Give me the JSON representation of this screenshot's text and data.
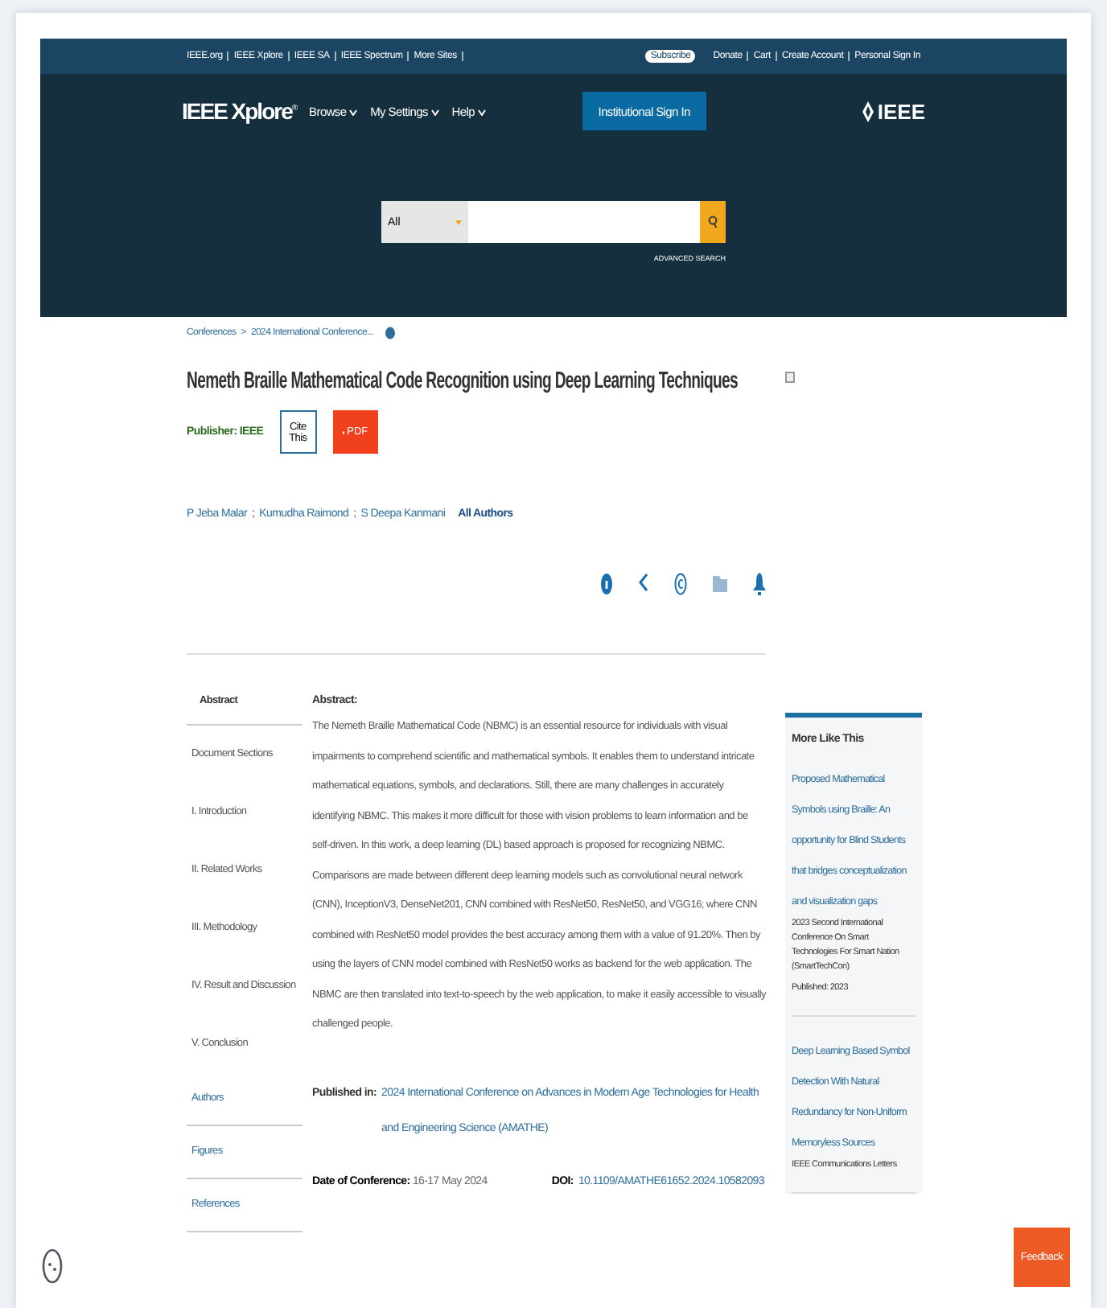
{
  "top_links": [
    "IEEE.org",
    "IEEE Xplore",
    "IEEE SA",
    "IEEE Spectrum",
    "More Sites"
  ],
  "subscribe": "Subscribe",
  "account_links": [
    "Donate",
    "Cart",
    "Create Account",
    "Personal Sign In"
  ],
  "logo": {
    "name": "IEEE Xplore",
    "mark": "®"
  },
  "nav": [
    "Browse",
    "My Settings",
    "Help"
  ],
  "institutional_sign_in": "Institutional Sign In",
  "brand": "IEEE",
  "search": {
    "scope": "All",
    "advanced": "ADVANCED SEARCH"
  },
  "breadcrumb": [
    "Conferences",
    "2024 International Conference..."
  ],
  "breadcrumb_separator": ">",
  "title": "Nemeth Braille Mathematical Code Recognition using Deep Learning Techniques",
  "publisher": "Publisher: IEEE",
  "cite": "Cite This",
  "pdf": "PDF",
  "authors": [
    "P Jeba Malar",
    "Kumudha Raimond",
    "S Deepa Kanmani"
  ],
  "author_separator": ";",
  "all_authors": "All Authors",
  "sections": [
    {
      "label": "Abstract",
      "kind": "tab",
      "selected": true
    },
    {
      "label": "Document Sections",
      "kind": "heading",
      "selected": false
    },
    {
      "label": "I. Introduction",
      "kind": "section",
      "selected": false
    },
    {
      "label": "II. Related Works",
      "kind": "section",
      "selected": false
    },
    {
      "label": "III. Methodology",
      "kind": "section",
      "selected": false
    },
    {
      "label": "IV. Result and Discussion",
      "kind": "section",
      "selected": false
    },
    {
      "label": "V. Conclusion",
      "kind": "section",
      "selected": false
    },
    {
      "label": "Authors",
      "kind": "link",
      "selected": false
    },
    {
      "label": "Figures",
      "kind": "link",
      "selected": false
    },
    {
      "label": "References",
      "kind": "link",
      "selected": false
    }
  ],
  "abstract": {
    "heading": "Abstract:",
    "text": "The Nemeth Braille Mathematical Code (NBMC) is an essential resource for individuals with visual impairments to comprehend scientific and mathematical symbols. It enables them to understand intricate mathematical equations, symbols, and declarations. Still, there are many challenges in accurately identifying NBMC. This makes it more difficult for those with vision problems to learn information and be self-driven. In this work, a deep learning (DL) based approach is proposed for recognizing NBMC. Comparisons are made between different deep learning models such as convolutional neural network (CNN), InceptionV3, DenseNet201, CNN combined with ResNet50, ResNet50, and VGG16; where CNN combined with ResNet50 model provides the best accuracy among them with a value of 91.20%. Then by using the layers of CNN model combined with ResNet50 works as backend for the web application. The NBMC are then translated into text-to-speech by the web application, to make it easily accessible to visually challenged people."
  },
  "published_in": {
    "label": "Published in:",
    "value": "2024 International Conference on Advances in Modern Age Technologies for Health and Engineering Science (AMATHE)"
  },
  "date": {
    "label": "Date of Conference:",
    "value": "16-17 May 2024"
  },
  "doi": {
    "label": "DOI:",
    "value": "10.1109/AMATHE61652.2024.10582093"
  },
  "more_like_this": {
    "heading": "More Like This",
    "items": [
      {
        "title": "Proposed Mathematical Symbols using Braille: An opportunity for Blind Students that bridges conceptualization and visualization gaps",
        "source": "2023 Second International Conference On Smart Technologies For Smart Nation (SmartTechCon)",
        "published": "Published: 2023"
      },
      {
        "title": "Deep Learning Based Symbol Detection With Natural Redundancy for Non-Uniform Memoryless Sources",
        "source": "IEEE Communications Letters"
      }
    ]
  },
  "feedback": "Feedback"
}
